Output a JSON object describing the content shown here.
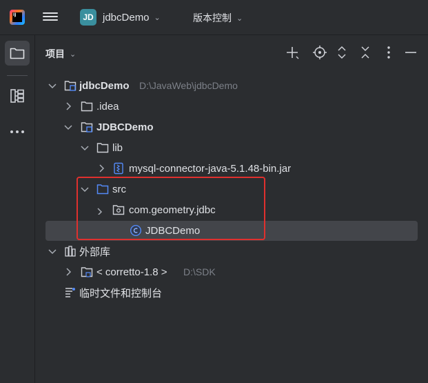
{
  "titlebar": {
    "app_logo_text": "IJ",
    "project_badge": "JD",
    "project_name": "jdbcDemo",
    "vcs_label": "版本控制"
  },
  "panel": {
    "title": "项目"
  },
  "tree": {
    "root": {
      "name": "jdbcDemo",
      "path": "D:\\JavaWeb\\jdbcDemo"
    },
    "idea": {
      "name": ".idea"
    },
    "module": {
      "name": "JDBCDemo"
    },
    "lib": {
      "name": "lib"
    },
    "jar": {
      "name": "mysql-connector-java-5.1.48-bin.jar"
    },
    "src": {
      "name": "src"
    },
    "package": {
      "name": "com.geometry.jdbc"
    },
    "class": {
      "name": "JDBCDemo"
    },
    "external_libs": {
      "name": "外部库"
    },
    "sdk": {
      "name": "< corretto-1.8 >",
      "path": "D:\\SDK"
    },
    "scratches": {
      "name": "临时文件和控制台"
    }
  },
  "colors": {
    "background": "#2b2d30",
    "selection": "#43454a",
    "highlight_box": "#e0302e",
    "folder_blue": "#548af7",
    "project_badge": "#3a8f9e"
  }
}
